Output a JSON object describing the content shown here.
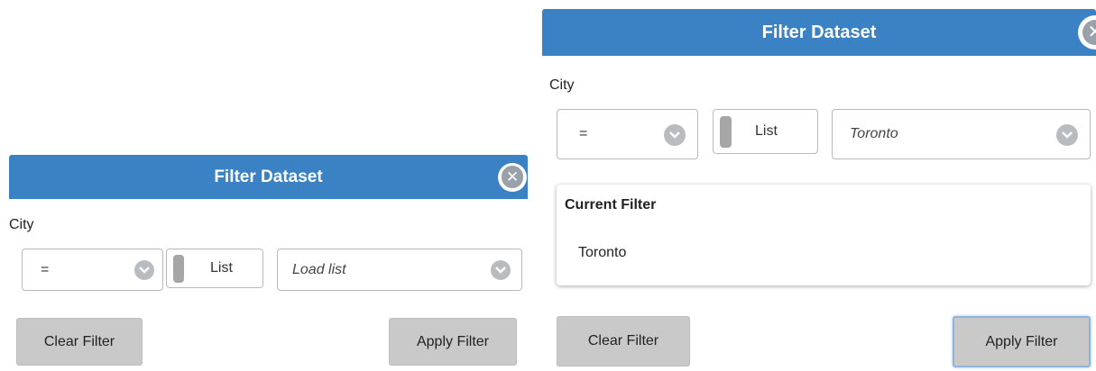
{
  "left_dialog": {
    "title": "Filter Dataset",
    "field_label": "City",
    "operator_value": "=",
    "list_toggle_label": "List",
    "value_placeholder": "Load list",
    "clear_button": "Clear Filter",
    "apply_button": "Apply Filter"
  },
  "right_dialog": {
    "title": "Filter Dataset",
    "field_label": "City",
    "operator_value": "=",
    "list_toggle_label": "List",
    "value_selected": "Toronto",
    "current_filter": {
      "heading": "Current Filter",
      "value": "Toronto"
    },
    "clear_button": "Clear Filter",
    "apply_button": "Apply Filter"
  },
  "colors": {
    "title_bar": "#3a82c4",
    "button_bg": "#c9c9c9",
    "focus_ring": "#8fb4dd"
  },
  "icons": {
    "close": "close-circle-icon",
    "dropdown": "chevron-down-circle-icon"
  }
}
